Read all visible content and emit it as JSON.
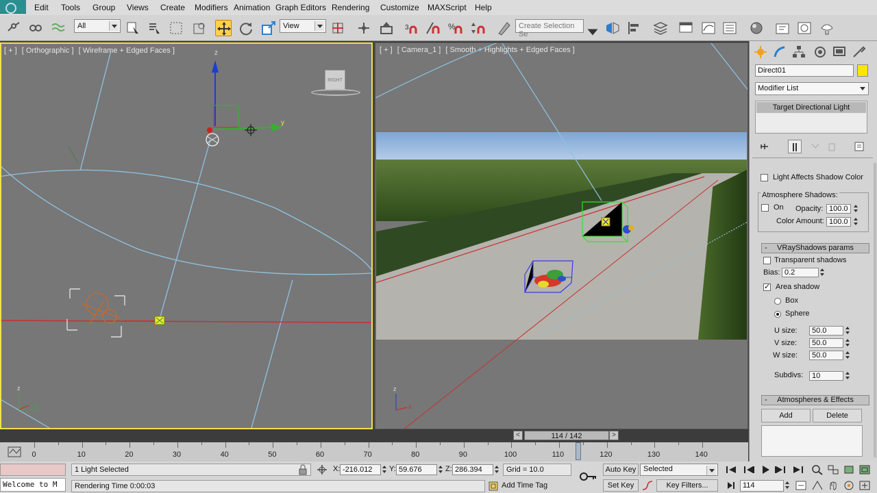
{
  "menu": {
    "items": [
      "Edit",
      "Tools",
      "Group",
      "Views",
      "Create",
      "Modifiers",
      "Animation",
      "Graph Editors",
      "Rendering",
      "Customize",
      "MAXScript",
      "Help"
    ]
  },
  "toolbar": {
    "selection_filter": "All",
    "reference_coord": "View",
    "named_selection_placeholder": "Create Selection Se"
  },
  "viewports": {
    "left": {
      "label_plus": "[ + ]",
      "label_view": "[ Orthographic ]",
      "label_shading": "[ Wireframe + Edged Faces ]",
      "viewcube_label": "RIGHT",
      "axis_x": "x",
      "axis_y": "y",
      "axis_z": "z"
    },
    "right": {
      "label_plus": "[ + ]",
      "label_view": "[ Camera_1 ]",
      "label_shading": "[ Smooth + Highlights + Edged Faces ]",
      "axis_x": "x",
      "axis_z": "z"
    }
  },
  "timeline": {
    "frame_display": "114 / 142",
    "current_frame": 114,
    "total_frames": 142,
    "prev_label": "<",
    "next_label": ">",
    "ticks": [
      "0",
      "10",
      "20",
      "30",
      "40",
      "50",
      "60",
      "70",
      "80",
      "90",
      "100",
      "110",
      "120",
      "130",
      "140"
    ]
  },
  "status": {
    "selection_info": "1 Light Selected",
    "prompt": "Rendering Time  0:00:03",
    "maxscript_listener": "Welcome to M",
    "x_label": "X:",
    "x_value": "-216.012",
    "y_label": "Y:",
    "y_value": "59.676",
    "z_label": "Z:",
    "z_value": "286.394",
    "grid": "Grid = 10.0",
    "add_time_tag": "Add Time Tag",
    "auto_key": "Auto Key",
    "set_key": "Set Key",
    "key_mode": "Selected",
    "key_filters": "Key Filters...",
    "frame_field": "114"
  },
  "command_panel": {
    "object_name": "Direct01",
    "object_color": "#ffe600",
    "modifier_list": "Modifier List",
    "stack_item": "Target Directional Light",
    "light_affects_shadow_color": "Light Affects Shadow Color",
    "atmosphere_shadows": {
      "title": "Atmosphere Shadows:",
      "on_label": "On",
      "opacity_label": "Opacity:",
      "opacity_value": "100.0",
      "color_amount_label": "Color Amount:",
      "color_amount_value": "100.0"
    },
    "vray_shadows": {
      "title": "VRayShadows params",
      "sign": "-",
      "transparent_shadows": "Transparent shadows",
      "bias_label": "Bias:",
      "bias_value": "0.2",
      "area_shadow": "Area shadow",
      "box_label": "Box",
      "sphere_label": "Sphere",
      "u_label": "U size:",
      "u_value": "50.0",
      "v_label": "V size:",
      "v_value": "50.0",
      "w_label": "W size:",
      "w_value": "50.0",
      "subdivs_label": "Subdivs:",
      "subdivs_value": "10"
    },
    "atmospheres_effects": {
      "title": "Atmospheres & Effects",
      "sign": "-",
      "add": "Add",
      "delete": "Delete"
    }
  },
  "colors": {
    "active_viewport_border": "#f0e050",
    "viewport_bg": "#777777",
    "accent_move": "#ffd24a"
  }
}
